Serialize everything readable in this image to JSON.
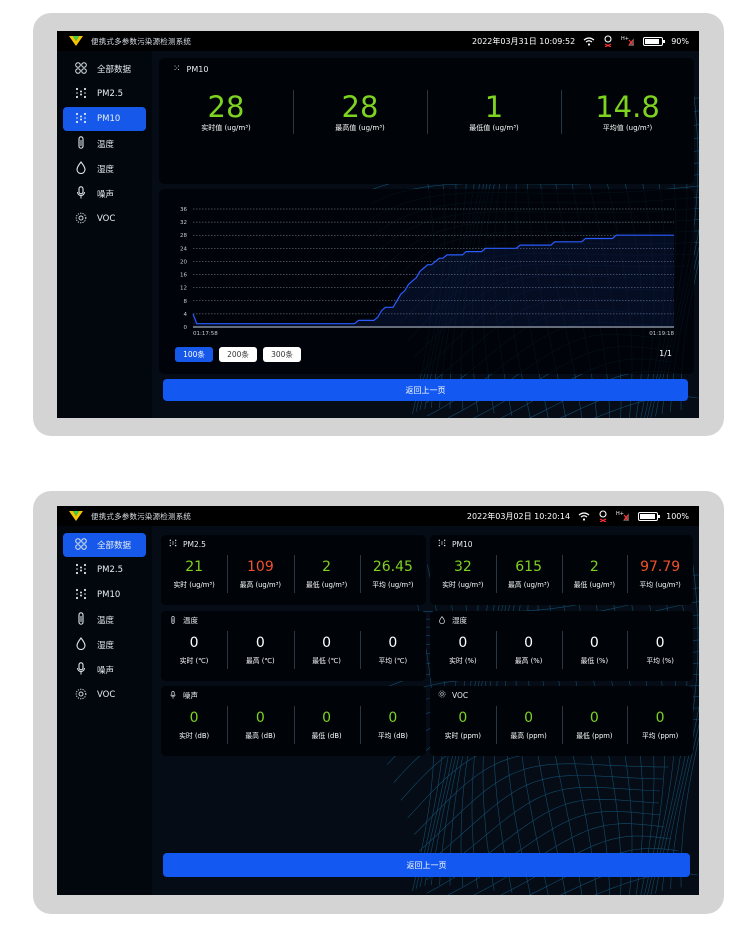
{
  "app_title": "便携式多参数污染源检测系统",
  "colors": {
    "accent": "#1659ea",
    "value_normal": "#7ed321",
    "value_high": "#f0512c",
    "chart_line": "#2a5cff"
  },
  "nav": [
    {
      "label": "全部数据",
      "icon": "grid-dots-icon"
    },
    {
      "label": "PM2.5",
      "icon": "particles-icon"
    },
    {
      "label": "PM10",
      "icon": "particles-icon"
    },
    {
      "label": "温度",
      "icon": "thermometer-icon"
    },
    {
      "label": "湿度",
      "icon": "droplet-icon"
    },
    {
      "label": "噪声",
      "icon": "microphone-icon"
    },
    {
      "label": "VOC",
      "icon": "voc-icon"
    }
  ],
  "screen1": {
    "datetime": "2022年03月31日 10:09:52",
    "battery": "90%",
    "battery_level": 0.9,
    "active_nav": 2,
    "panel_title": "PM10",
    "stats": [
      {
        "value": "28",
        "label": "实时值 (ug/m³)"
      },
      {
        "value": "28",
        "label": "最高值 (ug/m³)"
      },
      {
        "value": "1",
        "label": "最低值 (ug/m³)"
      },
      {
        "value": "14.8",
        "label": "平均值 (ug/m³)"
      }
    ],
    "page_buttons": [
      "100条",
      "200条",
      "300条"
    ],
    "page_indicator": "1/1",
    "back_button": "返回上一页"
  },
  "chart_data": {
    "type": "line",
    "x_start_label": "01:17:58",
    "x_end_label": "01:19:18",
    "yticks": [
      0,
      4,
      8,
      12,
      16,
      20,
      24,
      28,
      32,
      36
    ],
    "ylim": [
      0,
      36
    ],
    "grid": true,
    "series": [
      {
        "values": [
          4,
          1,
          1,
          1,
          1,
          1,
          1,
          1,
          1,
          1,
          1,
          1,
          1,
          1,
          1,
          1,
          1,
          1,
          1,
          1,
          1,
          1,
          1,
          1,
          1,
          1,
          1,
          1,
          1,
          1,
          1,
          1,
          1,
          1,
          1,
          1,
          1,
          1,
          1,
          1,
          1,
          1,
          1,
          2,
          2,
          2,
          2,
          2,
          3,
          5,
          6,
          6,
          6,
          8,
          10,
          11,
          13,
          14,
          15,
          17,
          18,
          19,
          19,
          20,
          21,
          21,
          22,
          22,
          22,
          22,
          22,
          23,
          23,
          23,
          23,
          23,
          24,
          24,
          24,
          24,
          24,
          24,
          24,
          24,
          24,
          25,
          25,
          25,
          25,
          25,
          25,
          25,
          25,
          25,
          26,
          26,
          26,
          26,
          26,
          26,
          26,
          26,
          27,
          27,
          27,
          27,
          27,
          27,
          27,
          27,
          28,
          28,
          28,
          28,
          28,
          28,
          28,
          28,
          28,
          28,
          28,
          28,
          28,
          28,
          28,
          28
        ]
      }
    ]
  },
  "screen2": {
    "datetime": "2022年03月02日 10:20:14",
    "battery": "100%",
    "battery_level": 1.0,
    "active_nav": 0,
    "back_button": "返回上一页",
    "cards": [
      {
        "title": "PM2.5",
        "icon": "particles-icon",
        "items": [
          {
            "value": "21",
            "label": "实时 (ug/m³)",
            "color": "#7ed321"
          },
          {
            "value": "109",
            "label": "最高 (ug/m³)",
            "color": "#f0512c"
          },
          {
            "value": "2",
            "label": "最低 (ug/m³)",
            "color": "#7ed321"
          },
          {
            "value": "26.45",
            "label": "平均 (ug/m³)",
            "color": "#7ed321"
          }
        ]
      },
      {
        "title": "PM10",
        "icon": "particles-icon",
        "items": [
          {
            "value": "32",
            "label": "实时 (ug/m³)",
            "color": "#7ed321"
          },
          {
            "value": "615",
            "label": "最高 (ug/m³)",
            "color": "#7ed321"
          },
          {
            "value": "2",
            "label": "最低 (ug/m³)",
            "color": "#7ed321"
          },
          {
            "value": "97.79",
            "label": "平均 (ug/m³)",
            "color": "#f0512c"
          }
        ]
      },
      {
        "title": "温度",
        "icon": "thermometer-icon",
        "items": [
          {
            "value": "0",
            "label": "实时 (℃)",
            "color": "#ffffff"
          },
          {
            "value": "0",
            "label": "最高 (℃)",
            "color": "#ffffff"
          },
          {
            "value": "0",
            "label": "最低 (℃)",
            "color": "#ffffff"
          },
          {
            "value": "0",
            "label": "平均 (℃)",
            "color": "#ffffff"
          }
        ]
      },
      {
        "title": "湿度",
        "icon": "droplet-icon",
        "items": [
          {
            "value": "0",
            "label": "实时 (%)",
            "color": "#ffffff"
          },
          {
            "value": "0",
            "label": "最高 (%)",
            "color": "#ffffff"
          },
          {
            "value": "0",
            "label": "最低 (%)",
            "color": "#ffffff"
          },
          {
            "value": "0",
            "label": "平均 (%)",
            "color": "#ffffff"
          }
        ]
      },
      {
        "title": "噪声",
        "icon": "microphone-icon",
        "items": [
          {
            "value": "0",
            "label": "实时 (dB)",
            "color": "#7ed321"
          },
          {
            "value": "0",
            "label": "最高 (dB)",
            "color": "#7ed321"
          },
          {
            "value": "0",
            "label": "最低 (dB)",
            "color": "#7ed321"
          },
          {
            "value": "0",
            "label": "平均 (dB)",
            "color": "#7ed321"
          }
        ]
      },
      {
        "title": "VOC",
        "icon": "voc-icon",
        "items": [
          {
            "value": "0",
            "label": "实时 (ppm)",
            "color": "#7ed321"
          },
          {
            "value": "0",
            "label": "最高 (ppm)",
            "color": "#7ed321"
          },
          {
            "value": "0",
            "label": "最低 (ppm)",
            "color": "#7ed321"
          },
          {
            "value": "0",
            "label": "平均 (ppm)",
            "color": "#7ed321"
          }
        ]
      }
    ]
  }
}
